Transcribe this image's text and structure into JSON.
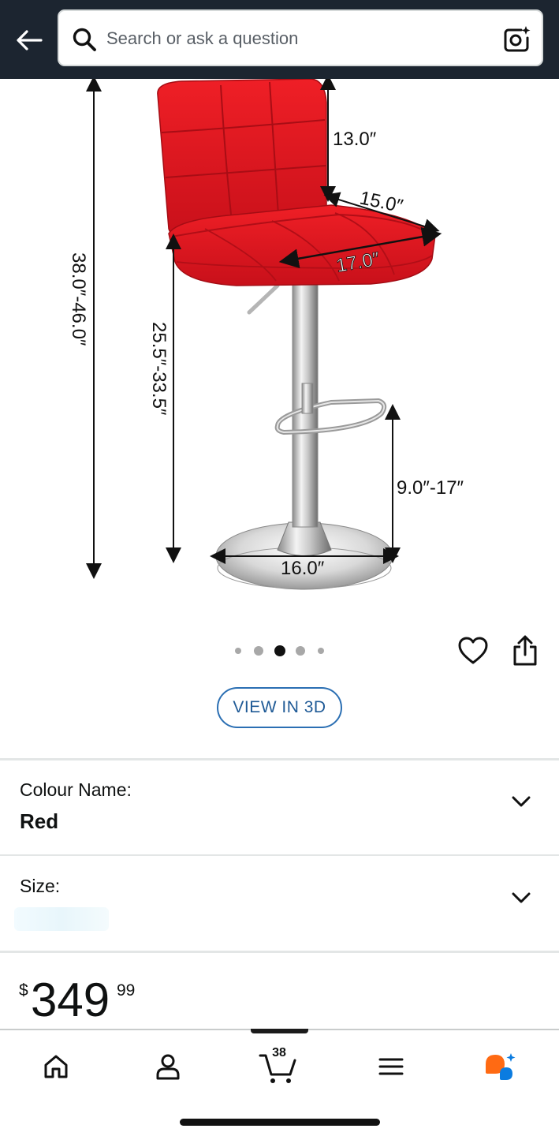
{
  "header": {
    "search_placeholder": "Search or ask a question"
  },
  "product_image": {
    "dimensions": {
      "back_height": "13.0″",
      "seat_depth": "15.0″",
      "seat_width": "17.0″",
      "total_height": "38.0″-46.0″",
      "seat_height": "25.5″-33.5″",
      "footrest_height": "9.0″-17″",
      "base_diameter": "16.0″"
    },
    "seat_color": "#e3121b"
  },
  "carousel": {
    "total": 5,
    "active_index": 2
  },
  "view_3d_label": "VIEW IN 3D",
  "options": {
    "colour": {
      "label": "Colour Name:",
      "value": "Red"
    },
    "size": {
      "label": "Size:"
    }
  },
  "price": {
    "symbol": "$",
    "whole": "349",
    "fraction": "99"
  },
  "bottom_nav": {
    "cart_count": "38",
    "items": [
      "home-icon",
      "account-icon",
      "cart-icon",
      "menu-icon",
      "rufus-icon"
    ]
  },
  "colors": {
    "header_bg": "#1c2530",
    "link_blue": "#2b6fb3",
    "rufus_orange": "#ff6a13",
    "rufus_blue": "#0b7ce0"
  }
}
